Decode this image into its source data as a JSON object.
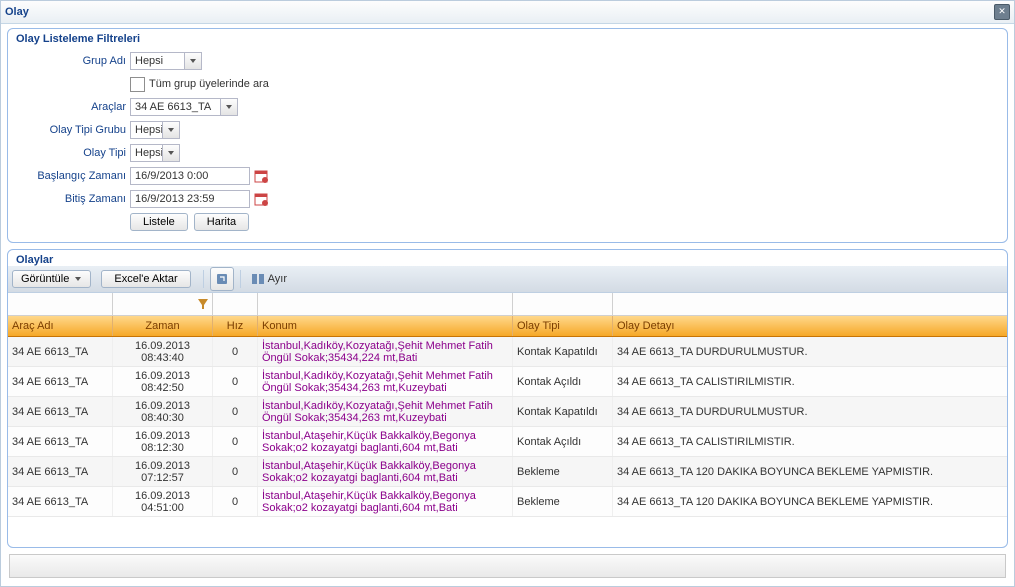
{
  "window": {
    "title": "Olay"
  },
  "filters": {
    "legend": "Olay Listeleme Filtreleri",
    "labels": {
      "grup": "Grup Adı",
      "tum_grup": "Tüm grup üyelerinde ara",
      "araclar": "Araçlar",
      "tip_grubu": "Olay Tipi Grubu",
      "tip": "Olay Tipi",
      "baslangic": "Başlangıç Zamanı",
      "bitis": "Bitiş Zamanı"
    },
    "values": {
      "grup": "Hepsi",
      "araclar": "34 AE 6613_TA",
      "tip_grubu": "Hepsi",
      "tip": "Hepsi",
      "baslangic": "16/9/2013 0:00",
      "bitis": "16/9/2013 23:59"
    },
    "buttons": {
      "listele": "Listele",
      "harita": "Harita"
    }
  },
  "events": {
    "title": "Olaylar",
    "toolbar": {
      "goruntule": "Görüntüle",
      "excel": "Excel'e Aktar",
      "ayir": "Ayır"
    },
    "columns": {
      "arac": "Araç Adı",
      "zaman": "Zaman",
      "hiz": "Hız",
      "konum": "Konum",
      "tip": "Olay Tipi",
      "detay": "Olay Detayı"
    },
    "rows": [
      {
        "arac": "34 AE 6613_TA",
        "zaman_date": "16.09.2013",
        "zaman_time": "08:43:40",
        "hiz": "0",
        "konum": "İstanbul,Kadıköy,Kozyatağı,Şehit Mehmet Fatih Öngül Sokak;35434,224 mt,Bati",
        "tip": "Kontak Kapatıldı",
        "detay": "34 AE 6613_TA DURDURULMUSTUR."
      },
      {
        "arac": "34 AE 6613_TA",
        "zaman_date": "16.09.2013",
        "zaman_time": "08:42:50",
        "hiz": "0",
        "konum": "İstanbul,Kadıköy,Kozyatağı,Şehit Mehmet Fatih Öngül Sokak;35434,263 mt,Kuzeybati",
        "tip": "Kontak Açıldı",
        "detay": "34 AE 6613_TA CALISTIRILMISTIR."
      },
      {
        "arac": "34 AE 6613_TA",
        "zaman_date": "16.09.2013",
        "zaman_time": "08:40:30",
        "hiz": "0",
        "konum": "İstanbul,Kadıköy,Kozyatağı,Şehit Mehmet Fatih Öngül Sokak;35434,263 mt,Kuzeybati",
        "tip": "Kontak Kapatıldı",
        "detay": "34 AE 6613_TA DURDURULMUSTUR."
      },
      {
        "arac": "34 AE 6613_TA",
        "zaman_date": "16.09.2013",
        "zaman_time": "08:12:30",
        "hiz": "0",
        "konum": "İstanbul,Ataşehir,Küçük Bakkalköy,Begonya Sokak;o2 kozayatgi baglanti,604 mt,Bati",
        "tip": "Kontak Açıldı",
        "detay": "34 AE 6613_TA CALISTIRILMISTIR."
      },
      {
        "arac": "34 AE 6613_TA",
        "zaman_date": "16.09.2013",
        "zaman_time": "07:12:57",
        "hiz": "0",
        "konum": "İstanbul,Ataşehir,Küçük Bakkalköy,Begonya Sokak;o2 kozayatgi baglanti,604 mt,Bati",
        "tip": "Bekleme",
        "detay": "34 AE 6613_TA 120 DAKIKA BOYUNCA BEKLEME YAPMISTIR."
      },
      {
        "arac": "34 AE 6613_TA",
        "zaman_date": "16.09.2013",
        "zaman_time": "04:51:00",
        "hiz": "0",
        "konum": "İstanbul,Ataşehir,Küçük Bakkalköy,Begonya Sokak;o2 kozayatgi baglanti,604 mt,Bati",
        "tip": "Bekleme",
        "detay": "34 AE 6613_TA 120 DAKIKA BOYUNCA BEKLEME YAPMISTIR."
      }
    ]
  }
}
